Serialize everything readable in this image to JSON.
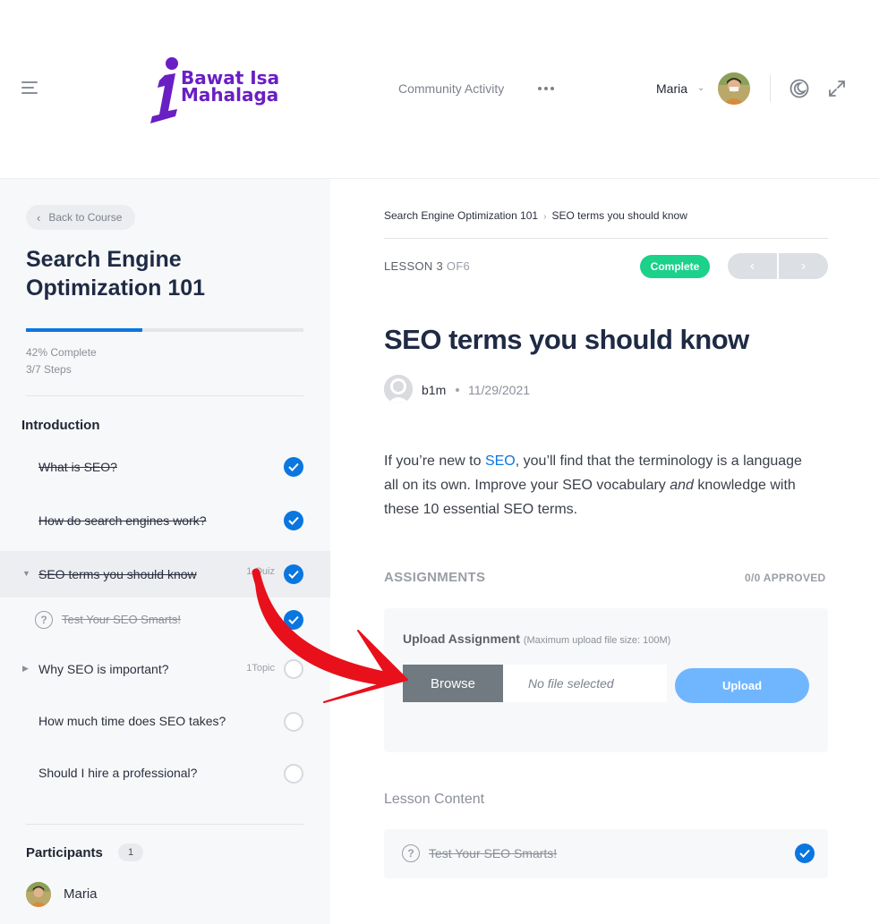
{
  "header": {
    "logo_text_line1": "Bawat Isa",
    "logo_text_line2": "Mahalaga",
    "nav_link": "Community Activity",
    "user_name": "Maria"
  },
  "sidebar": {
    "back_label": "Back to Course",
    "course_title": "Search Engine Optimization 101",
    "progress_percent": 42,
    "progress_text": "42% Complete",
    "steps_text": "3/7 Steps",
    "section_title": "Introduction",
    "lessons": [
      {
        "label": "What is SEO?",
        "meta": "",
        "status": "complete"
      },
      {
        "label": "How do search engines work?",
        "meta": "",
        "status": "complete"
      },
      {
        "label": "SEO terms you should know",
        "meta": "1 Quiz",
        "status": "complete"
      },
      {
        "label": "Test Your SEO Smarts!",
        "meta": "",
        "status": "complete"
      },
      {
        "label": "Why SEO is important?",
        "meta": "1Topic",
        "status": "incomplete"
      },
      {
        "label": "How much time does SEO takes?",
        "meta": "",
        "status": "incomplete"
      },
      {
        "label": "Should I hire a professional?",
        "meta": "",
        "status": "incomplete"
      }
    ],
    "participants_title": "Participants",
    "participants_count": "1",
    "participant_name": "Maria"
  },
  "main": {
    "breadcrumb": [
      "Search Engine Optimization 101",
      "SEO terms you should know"
    ],
    "lesson_prefix": "LESSON 3",
    "lesson_suffix": "OF6",
    "complete_badge": "Complete",
    "title": "SEO terms you should know",
    "author": "b1m",
    "date": "11/29/2021",
    "para_part1": "If you’re new to ",
    "para_link": "SEO",
    "para_part2": ", you’ll find that the terminology is a language all on its own. Improve your SEO vocabulary ",
    "para_em": "and",
    "para_part3": " knowledge with these 10 essential SEO terms.",
    "assignments_title": "ASSIGNMENTS",
    "approved_text": "0/0 APPROVED",
    "upload_label": "Upload Assignment",
    "upload_note": "(Maximum upload file size: 100M)",
    "browse_label": "Browse",
    "file_placeholder": "No file selected",
    "upload_button": "Upload",
    "content_title": "Lesson Content",
    "content_item": "Test Your SEO Smarts!"
  },
  "colors": {
    "accent": "#0a76e0",
    "complete_green": "#1cd18a",
    "logo_purple": "#6a1fc4",
    "arrow_red": "#e8101b"
  }
}
